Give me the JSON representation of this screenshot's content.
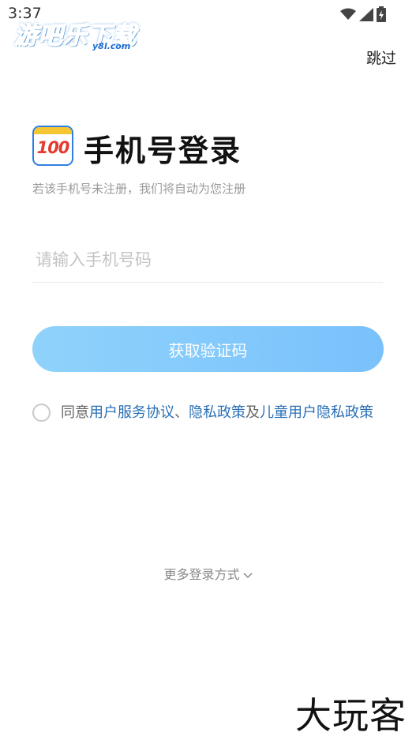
{
  "status_bar": {
    "time": "3:37"
  },
  "watermark_top": {
    "text": "游吧乐下载",
    "sub": "y8l.com"
  },
  "header": {
    "skip_label": "跳过"
  },
  "app_logo": {
    "text": "100"
  },
  "login": {
    "title": "手机号登录",
    "subtitle": "若该手机号未注册，我们将自动为您注册",
    "phone_placeholder": "请输入手机号码",
    "phone_value": "",
    "get_code_label": "获取验证码"
  },
  "agreement": {
    "prefix": "同意",
    "user_agreement": "用户服务协议",
    "sep1": "、",
    "privacy": "隐私政策",
    "and": "及",
    "child_privacy": "儿童用户隐私政策",
    "checked": false
  },
  "more_login": {
    "label": "更多登录方式"
  },
  "watermark_bottom": {
    "text": "大玩客"
  },
  "colors": {
    "button_start": "#8fd3fb",
    "button_end": "#79c1fc",
    "link": "#2a6fb5",
    "logo_red": "#e53a2e",
    "logo_yellow": "#f6c633"
  }
}
